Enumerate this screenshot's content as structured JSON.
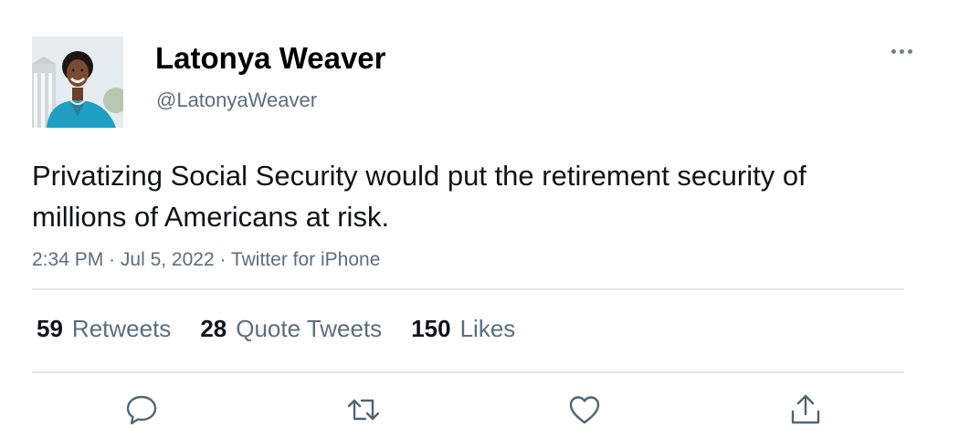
{
  "user": {
    "display_name": "Latonya Weaver",
    "handle": "@LatonyaWeaver"
  },
  "tweet": {
    "text": "Privatizing Social Security would put the retirement security of millions of Americans at risk.",
    "time": "2:34 PM",
    "separator": "·",
    "date": "Jul 5, 2022",
    "source": "Twitter for iPhone"
  },
  "stats": {
    "retweets": {
      "count": "59",
      "label": "Retweets"
    },
    "quote_tweets": {
      "count": "28",
      "label": "Quote Tweets"
    },
    "likes": {
      "count": "150",
      "label": "Likes"
    }
  },
  "actions": [
    "reply-icon",
    "retweet-icon",
    "like-icon",
    "share-icon"
  ],
  "colors": {
    "text": "#0f1419",
    "secondary": "#5b6e7c",
    "divider": "#e3e7ea",
    "icon": "#536471"
  }
}
